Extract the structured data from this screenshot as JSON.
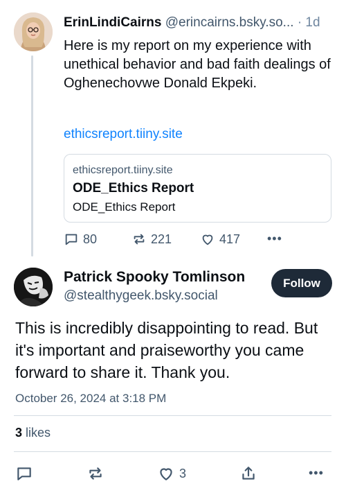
{
  "parent_post": {
    "author_name": "ErinLindiCairns",
    "author_handle": "@erincairns.bsky.so...",
    "separator": "·",
    "age": "1d",
    "text": "Here is my report on my experience with unethical behavior and bad faith dealings of Oghenechovwe Donald Ekpeki.",
    "link_text": "ethicsreport.tiiny.site",
    "link_card": {
      "domain": "ethicsreport.tiiny.site",
      "title": "ODE_Ethics Report",
      "description": "ODE_Ethics Report"
    },
    "actions": {
      "replies": "80",
      "reposts": "221",
      "likes": "417",
      "more": "•••"
    }
  },
  "main_post": {
    "author_name": "Patrick Spooky Tomlinson",
    "author_handle": "@stealthygeek.bsky.social",
    "follow_label": "Follow",
    "text": "This is incredibly disappointing to read. But it's important and praiseworthy you came forward to share it. Thank you.",
    "timestamp": "October 26, 2024 at 3:18 PM",
    "likes_count": "3",
    "likes_label": "likes",
    "actions": {
      "likes": "3",
      "more": "•••"
    }
  },
  "colors": {
    "link": "#1083fe",
    "muted": "#42576c",
    "follow_bg": "#1e2a38",
    "divider": "#d4dbe2"
  }
}
